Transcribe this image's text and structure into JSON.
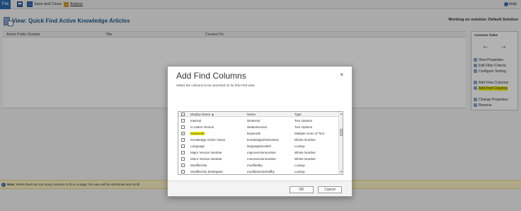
{
  "toolbar": {
    "file": "File",
    "save_close": "Save and Close",
    "actions": "Actions",
    "help": "Help"
  },
  "header": {
    "title": "View: Quick Find Active Knowledge Articles",
    "working_on": "Working on solution: Default Solution"
  },
  "grid": {
    "columns": [
      "Article Public Number",
      "Title",
      "Created On"
    ]
  },
  "common_tasks": {
    "title": "Common Tasks",
    "left_arrow": "←",
    "right_arrow": "→",
    "items": [
      "View Properties",
      "Edit Filter Criteria",
      "Configure Sorting",
      "Add View Columns",
      "Add Find Columns",
      "Change Properties",
      "Remove"
    ]
  },
  "note": {
    "label": "Note:",
    "text": "When there are too many columns to fit on a page, the view will be shortened and scroll"
  },
  "dialog": {
    "title": "Add Find Columns",
    "close": "×",
    "instruction": "Select the columns to be searched on for this Find view.",
    "columns": {
      "display_name": "Display Name ▲",
      "name": "Name",
      "type": "Type"
    },
    "rows": [
      {
        "display": "Internal",
        "name": "isinternal",
        "type": "Two Options",
        "checked": false
      },
      {
        "display": "Is Latest Version",
        "name": "islatestversion",
        "type": "Two Options",
        "checked": false
      },
      {
        "display": "Keywords",
        "name": "keywords",
        "type": "Multiple Lines of Text",
        "checked": true
      },
      {
        "display": "Knowledge Article Views",
        "name": "knowledgearticleviews",
        "type": "Whole Number",
        "checked": false
      },
      {
        "display": "Language",
        "name": "languagelocaleid",
        "type": "Lookup",
        "checked": false
      },
      {
        "display": "Major Version Number",
        "name": "majorversionnumber",
        "type": "Whole Number",
        "checked": false
      },
      {
        "display": "Minor Version Number",
        "name": "minorversionnumber",
        "type": "Whole Number",
        "checked": false
      },
      {
        "display": "Modified By",
        "name": "modifiedby",
        "type": "Lookup",
        "checked": false
      },
      {
        "display": "Modified By (Delegate)",
        "name": "modifiedonbehalfby",
        "type": "Lookup",
        "checked": false
      }
    ],
    "ok": "OK",
    "cancel": "Cancel"
  },
  "colors": {
    "highlight": "#f5f20a",
    "title_blue": "#1e5a8a",
    "file_blue": "#2b6cb0"
  }
}
